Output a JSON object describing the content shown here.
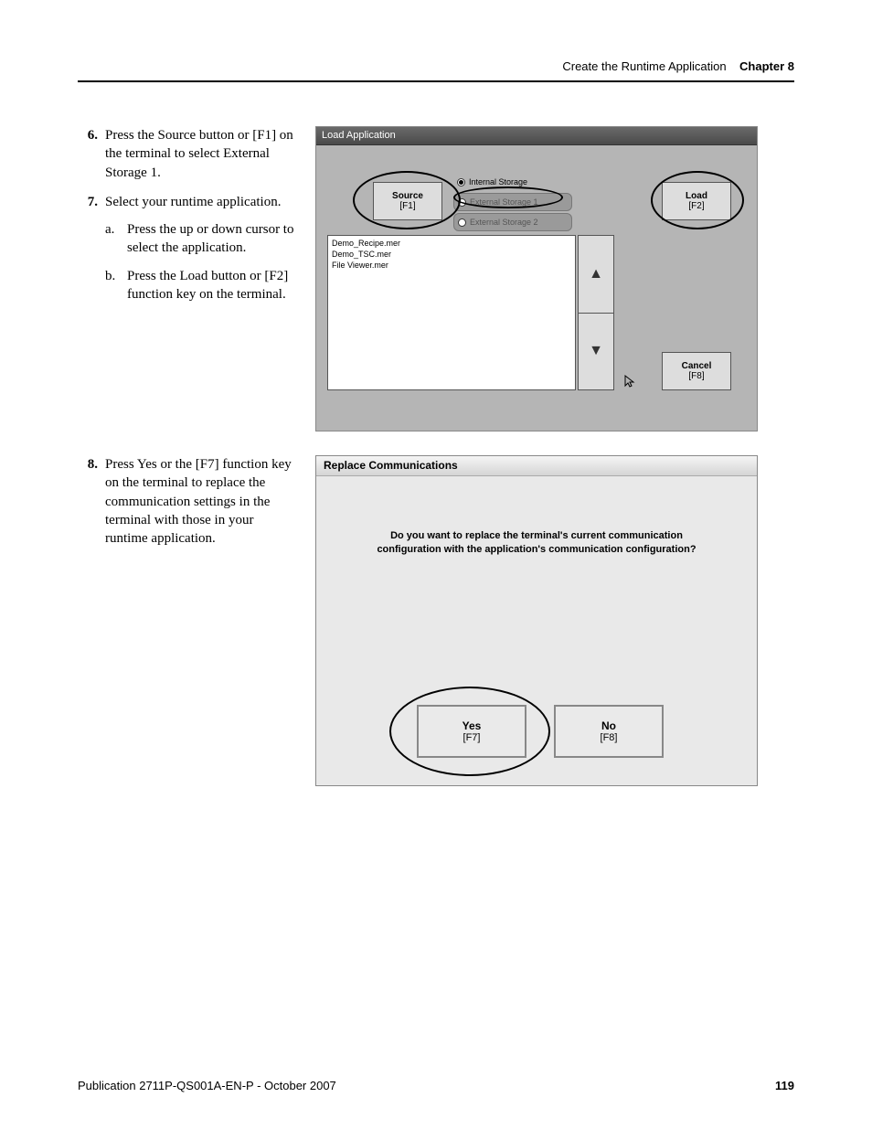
{
  "header": {
    "section": "Create the Runtime Application",
    "chapter": "Chapter 8"
  },
  "steps": {
    "s6": {
      "num": "6.",
      "text": "Press the Source button or [F1] on the terminal to select External Storage 1."
    },
    "s7": {
      "num": "7.",
      "text": "Select your runtime application."
    },
    "s7a": {
      "sn": "a.",
      "text": "Press the up or down cursor to select the application."
    },
    "s7b": {
      "sn": "b.",
      "text": "Press the Load button or [F2] function key on the terminal."
    },
    "s8": {
      "num": "8.",
      "text": "Press Yes or the [F7] function key on the terminal to replace the communication settings in the terminal with those in your runtime application."
    }
  },
  "loadapp": {
    "title": "Load Application",
    "source_label": "Source",
    "source_key": "[F1]",
    "load_label": "Load",
    "load_key": "[F2]",
    "cancel_label": "Cancel",
    "cancel_key": "[F8]",
    "radios": {
      "internal": "Internal Storage",
      "ext1": "External Storage 1",
      "ext2": "External Storage 2"
    },
    "files": {
      "f1": "Demo_Recipe.mer",
      "f2": "Demo_TSC.mer",
      "f3": "File Viewer.mer"
    }
  },
  "replacedlg": {
    "title": "Replace Communications",
    "msg1": "Do you want to replace the terminal's current communication",
    "msg2": "configuration with the application's communication configuration?",
    "yes_label": "Yes",
    "yes_key": "[F7]",
    "no_label": "No",
    "no_key": "[F8]"
  },
  "footer": {
    "pub": "Publication 2711P-QS001A-EN-P - October 2007",
    "page": "119"
  }
}
